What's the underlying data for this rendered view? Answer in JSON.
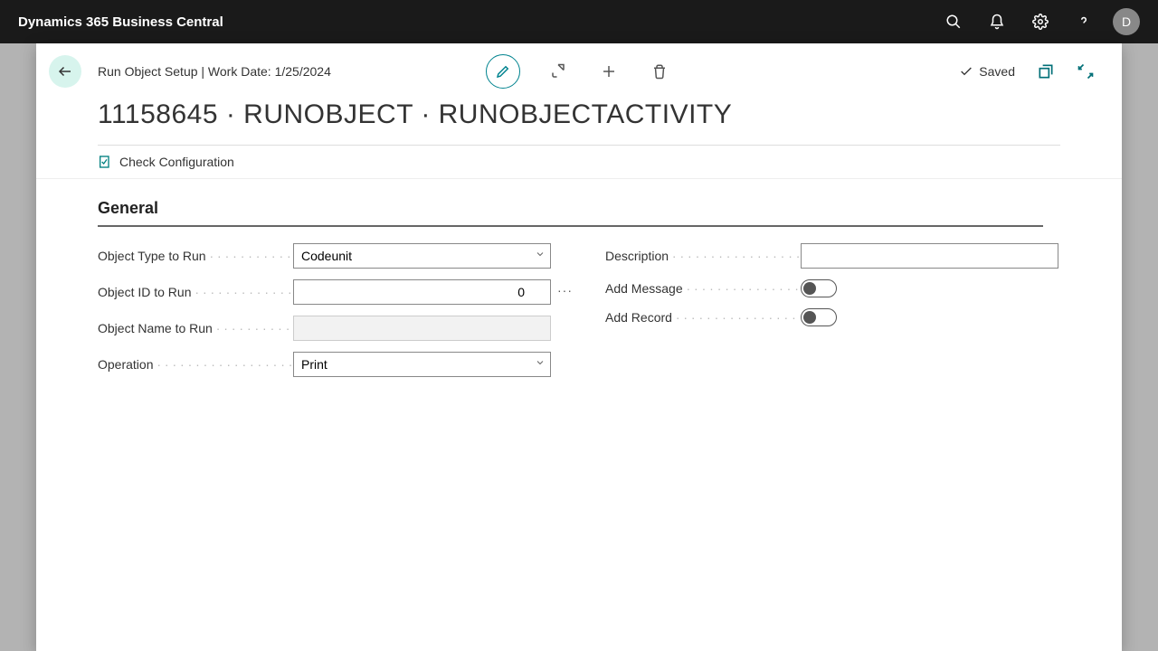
{
  "shell": {
    "product_name": "Dynamics 365 Business Central",
    "avatar_initial": "D"
  },
  "page": {
    "breadcrumb": "Run Object Setup | Work Date: 1/25/2024",
    "title": "11158645 · RUNOBJECT · RUNOBJECTACTIVITY",
    "saved_label": "Saved"
  },
  "actions": {
    "check_configuration": "Check Configuration"
  },
  "sections": {
    "general": "General"
  },
  "fields": {
    "object_type_to_run": {
      "label": "Object Type to Run",
      "value": "Codeunit"
    },
    "object_id_to_run": {
      "label": "Object ID to Run",
      "value": "0"
    },
    "object_name_to_run": {
      "label": "Object Name to Run",
      "value": ""
    },
    "operation": {
      "label": "Operation",
      "value": "Print"
    },
    "description": {
      "label": "Description",
      "value": ""
    },
    "add_message": {
      "label": "Add Message",
      "value": false
    },
    "add_record": {
      "label": "Add Record",
      "value": false
    }
  }
}
